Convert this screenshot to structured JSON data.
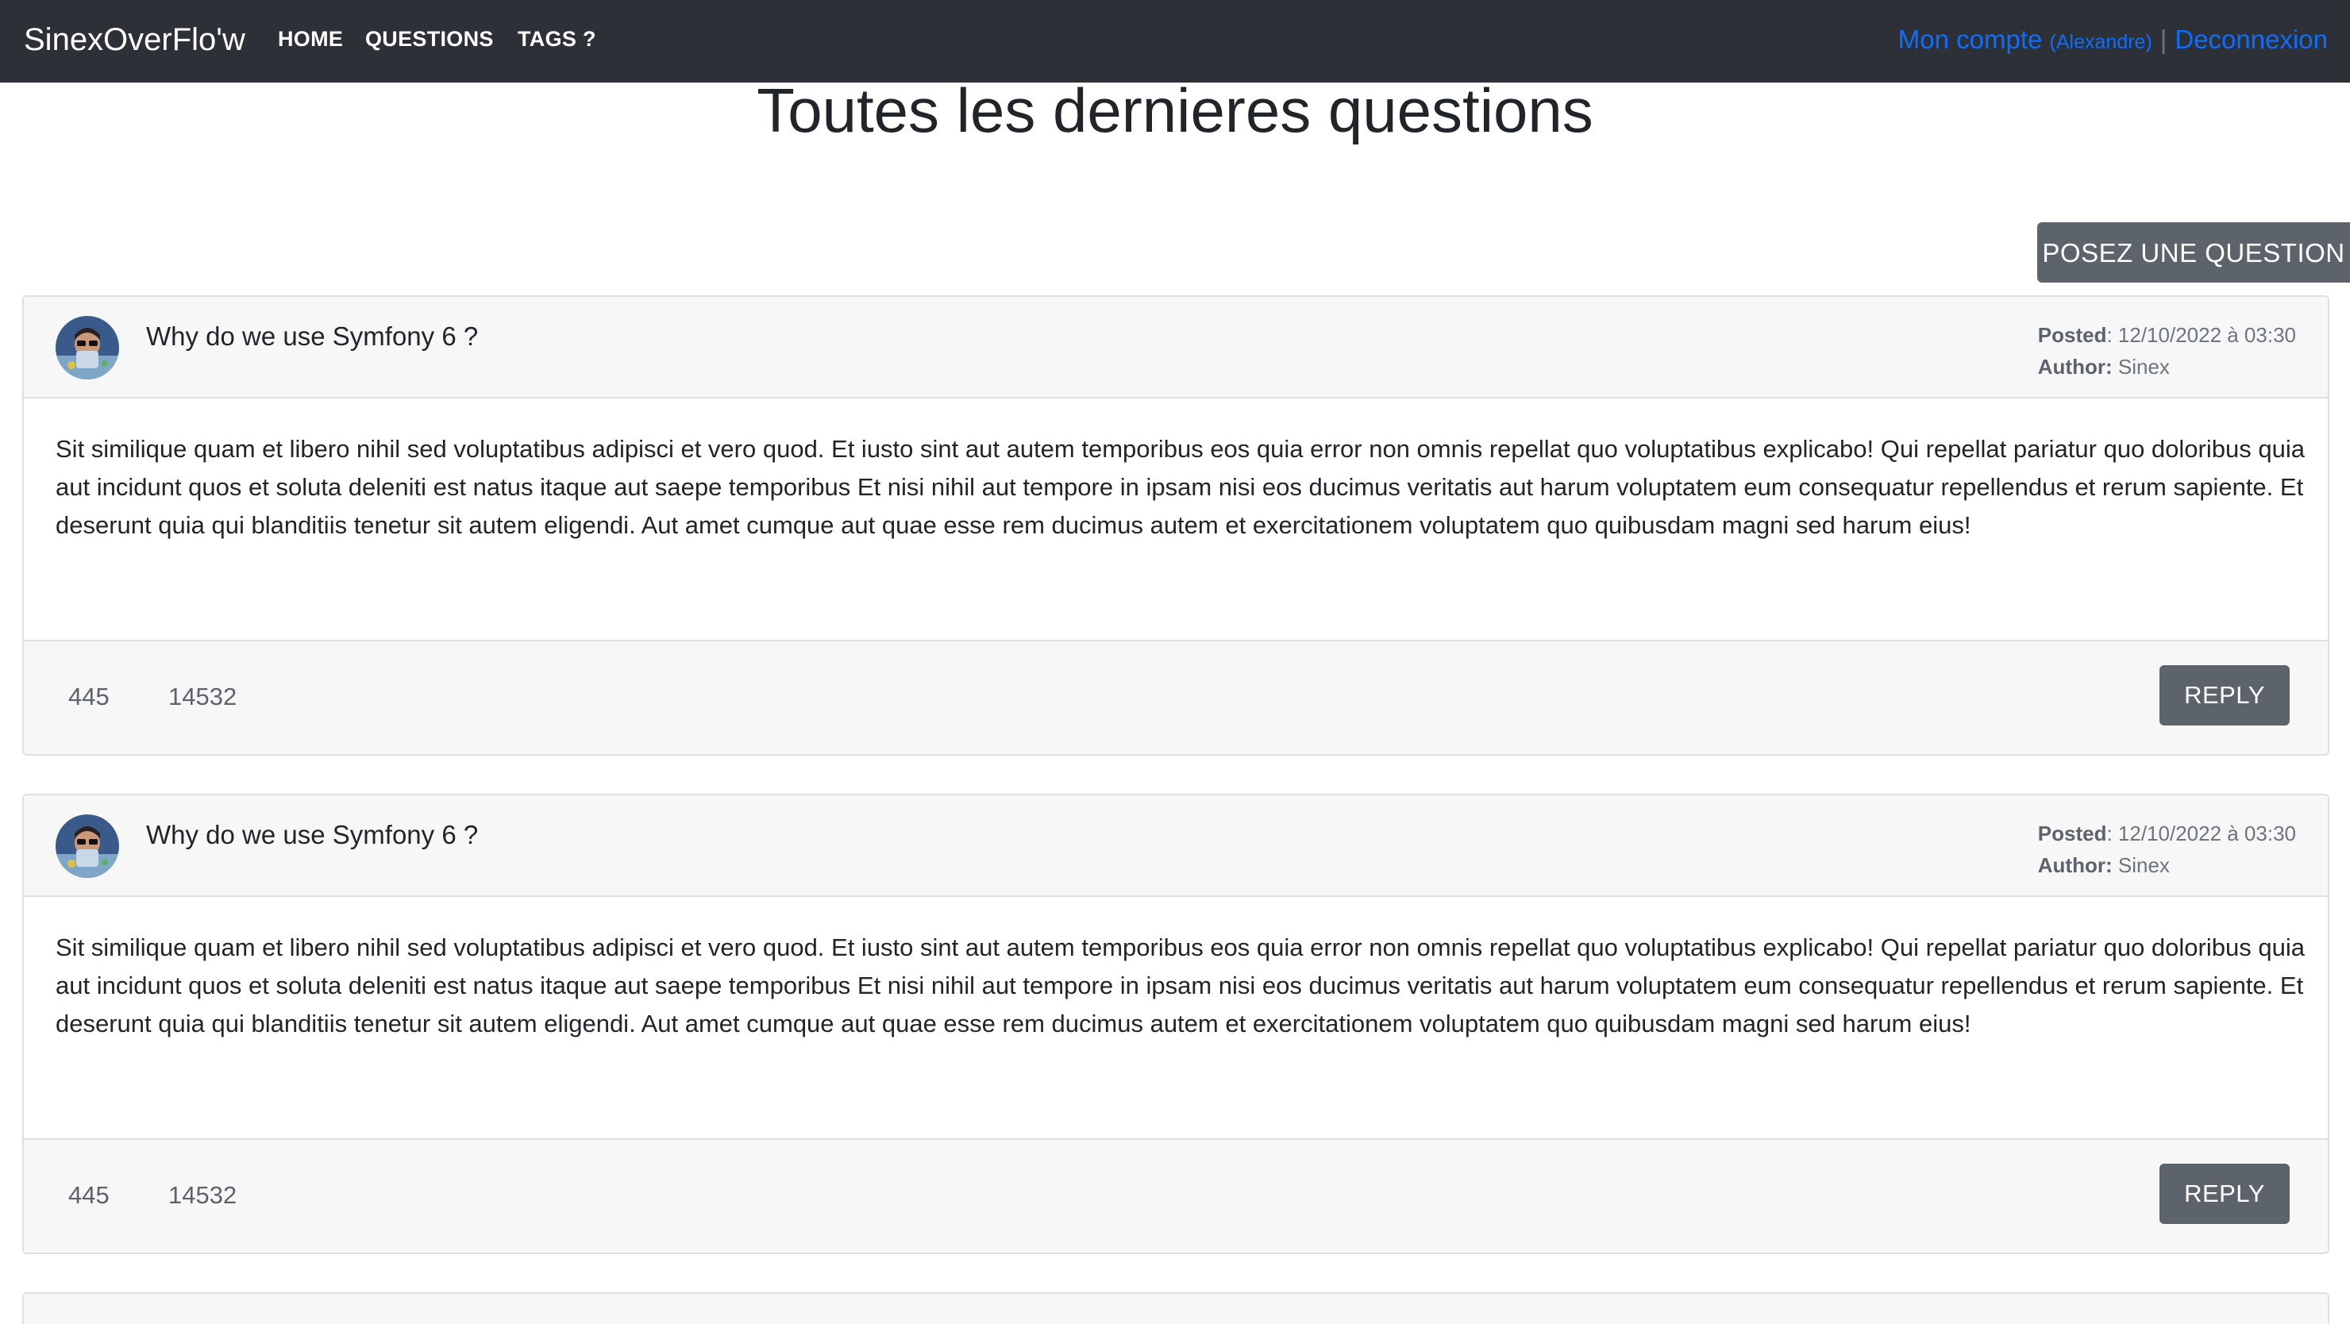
{
  "navbar": {
    "brand": "SinexOverFlo'w",
    "links": [
      "HOME",
      "QUESTIONS",
      "TAGS ?"
    ],
    "account_label": "Mon compte",
    "account_user": "(Alexandre)",
    "separator": "|",
    "logout_label": "Deconnexion"
  },
  "page": {
    "title": "Toutes les dernieres questions",
    "ask_button": "POSEZ UNE QUESTION"
  },
  "questions": [
    {
      "title": "Why do we use Symfony 6 ?",
      "posted_label": "Posted",
      "posted_value": ": 12/10/2022 à 03:30",
      "author_label": "Author:",
      "author_value": "Sinex",
      "body": "Sit similique quam et libero nihil sed voluptatibus adipisci et vero quod. Et iusto sint aut autem temporibus eos quia error non omnis repellat quo voluptatibus explicabo! Qui repellat pariatur quo doloribus quia aut incidunt quos et soluta deleniti est natus itaque aut saepe temporibus Et nisi nihil aut tempore in ipsam nisi eos ducimus veritatis aut harum voluptatem eum consequatur repellendus et rerum sapiente. Et deserunt quia qui blanditiis tenetur sit autem eligendi. Aut amet cumque aut quae esse rem ducimus autem et exercitationem voluptatem quo quibusdam magni sed harum eius!",
      "votes": "445",
      "views": "14532",
      "reply_label": "REPLY"
    },
    {
      "title": "Why do we use Symfony 6 ?",
      "posted_label": "Posted",
      "posted_value": ": 12/10/2022 à 03:30",
      "author_label": "Author:",
      "author_value": "Sinex",
      "body": "Sit similique quam et libero nihil sed voluptatibus adipisci et vero quod. Et iusto sint aut autem temporibus eos quia error non omnis repellat quo voluptatibus explicabo! Qui repellat pariatur quo doloribus quia aut incidunt quos et soluta deleniti est natus itaque aut saepe temporibus Et nisi nihil aut tempore in ipsam nisi eos ducimus veritatis aut harum voluptatem eum consequatur repellendus et rerum sapiente. Et deserunt quia qui blanditiis tenetur sit autem eligendi. Aut amet cumque aut quae esse rem ducimus autem et exercitationem voluptatem quo quibusdam magni sed harum eius!",
      "votes": "445",
      "views": "14532",
      "reply_label": "REPLY"
    }
  ],
  "icons": {
    "avatar": "user-avatar-photo"
  },
  "colors": {
    "navbar_bg": "#2d3137",
    "link_blue": "#0d6efd",
    "button_gray": "#5c636a",
    "card_header_bg": "#f7f7f7"
  }
}
